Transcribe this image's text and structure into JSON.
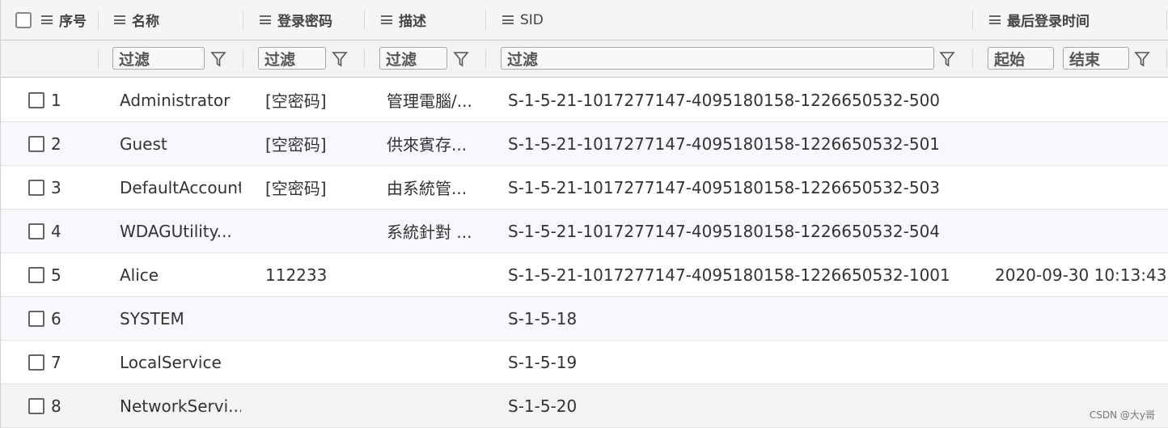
{
  "header": {
    "cols": [
      {
        "label": "序号"
      },
      {
        "label": "名称"
      },
      {
        "label": "登录密码"
      },
      {
        "label": "描述"
      },
      {
        "label": "SID"
      },
      {
        "label": "最后登录时间"
      }
    ]
  },
  "filters": {
    "name": "过滤",
    "password": "过滤",
    "desc": "过滤",
    "sid": "过滤",
    "start": "起始",
    "end": "结束"
  },
  "rows": [
    {
      "num": "1",
      "name": "Administrator",
      "password": "[空密码]",
      "desc": "管理電腦/...",
      "sid": "S-1-5-21-1017277147-4095180158-1226650532-500",
      "last_login": ""
    },
    {
      "num": "2",
      "name": "Guest",
      "password": "[空密码]",
      "desc": "供來賓存...",
      "sid": "S-1-5-21-1017277147-4095180158-1226650532-501",
      "last_login": ""
    },
    {
      "num": "3",
      "name": "DefaultAccount",
      "password": "[空密码]",
      "desc": "由系統管...",
      "sid": "S-1-5-21-1017277147-4095180158-1226650532-503",
      "last_login": ""
    },
    {
      "num": "4",
      "name": "WDAGUtility...",
      "password": "",
      "desc": "系統針對 ...",
      "sid": "S-1-5-21-1017277147-4095180158-1226650532-504",
      "last_login": ""
    },
    {
      "num": "5",
      "name": "Alice",
      "password": "112233",
      "desc": "",
      "sid": "S-1-5-21-1017277147-4095180158-1226650532-1001",
      "last_login": "2020-09-30 10:13:43"
    },
    {
      "num": "6",
      "name": "SYSTEM",
      "password": "",
      "desc": "",
      "sid": "S-1-5-18",
      "last_login": ""
    },
    {
      "num": "7",
      "name": "LocalService",
      "password": "",
      "desc": "",
      "sid": "S-1-5-19",
      "last_login": ""
    },
    {
      "num": "8",
      "name": "NetworkServi...",
      "password": "",
      "desc": "",
      "sid": "S-1-5-20",
      "last_login": ""
    }
  ],
  "watermark": "CSDN @大y哥"
}
